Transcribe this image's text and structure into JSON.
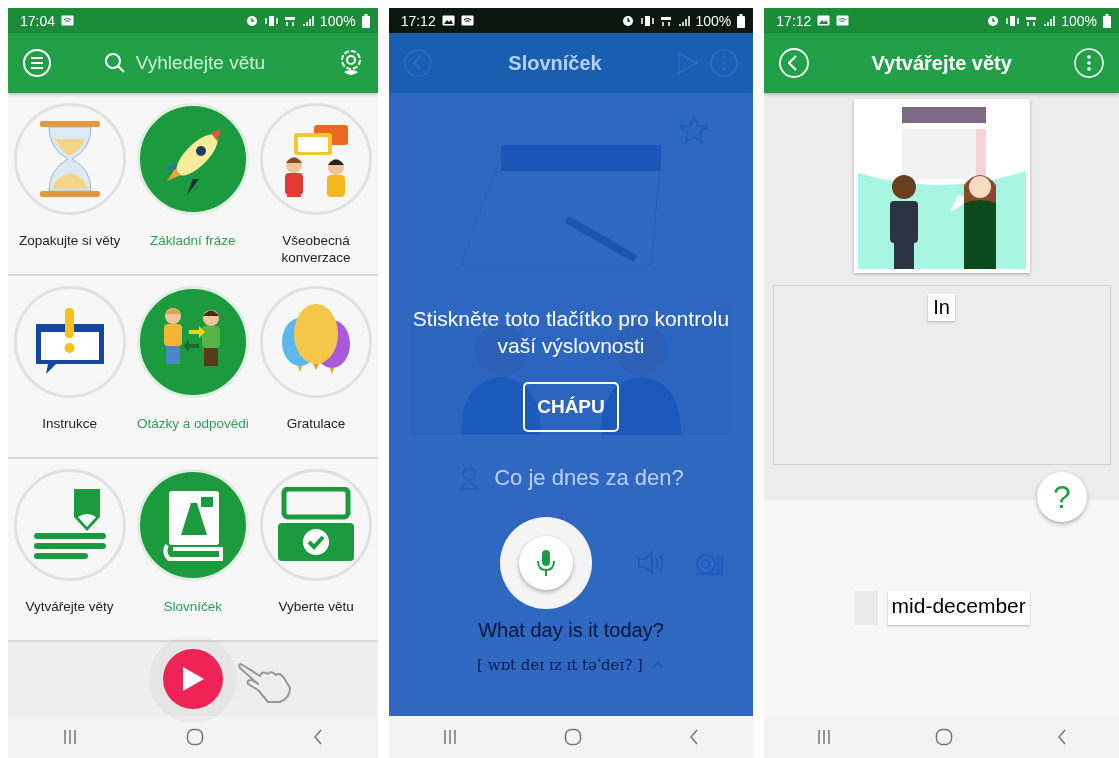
{
  "home_screen": {
    "status": {
      "time": "17:04",
      "battery": "100%"
    },
    "search": {
      "placeholder": "Vyhledejte větu"
    },
    "tiles": [
      {
        "label": "Zopakujte si věty",
        "active": false
      },
      {
        "label": "Základní fráze",
        "active": true
      },
      {
        "label": "Všeobecná konverzace",
        "active": false
      },
      {
        "label": "Instrukce",
        "active": false
      },
      {
        "label": "Otázky a odpovědi",
        "active": true
      },
      {
        "label": "Gratulace",
        "active": false
      },
      {
        "label": "Vytvářejte věty",
        "active": false
      },
      {
        "label": "Slovníček",
        "active": true
      },
      {
        "label": "Vyberte větu",
        "active": false
      }
    ]
  },
  "tutorial_screen": {
    "status": {
      "time": "17:12",
      "battery": "100%"
    },
    "title": "Slovníček",
    "starred": false,
    "phrase": "Co je dnes za den?",
    "translation": "What day is it today?",
    "transcription": "[ wɒt deɪ ɪz ɪt təˈdeɪ? ]",
    "coach": {
      "message": "Stiskněte toto tlačítko pro kontrolu vaší výslovnosti",
      "button": "CHÁPU"
    }
  },
  "build_screen": {
    "status": {
      "time": "17:12",
      "battery": "100%"
    },
    "title": "Vytvářejte věty",
    "answer_words": [
      "In"
    ],
    "help_button": "?",
    "choices": [
      {
        "used": true
      },
      {
        "word": "mid-december",
        "used": false
      }
    ]
  }
}
